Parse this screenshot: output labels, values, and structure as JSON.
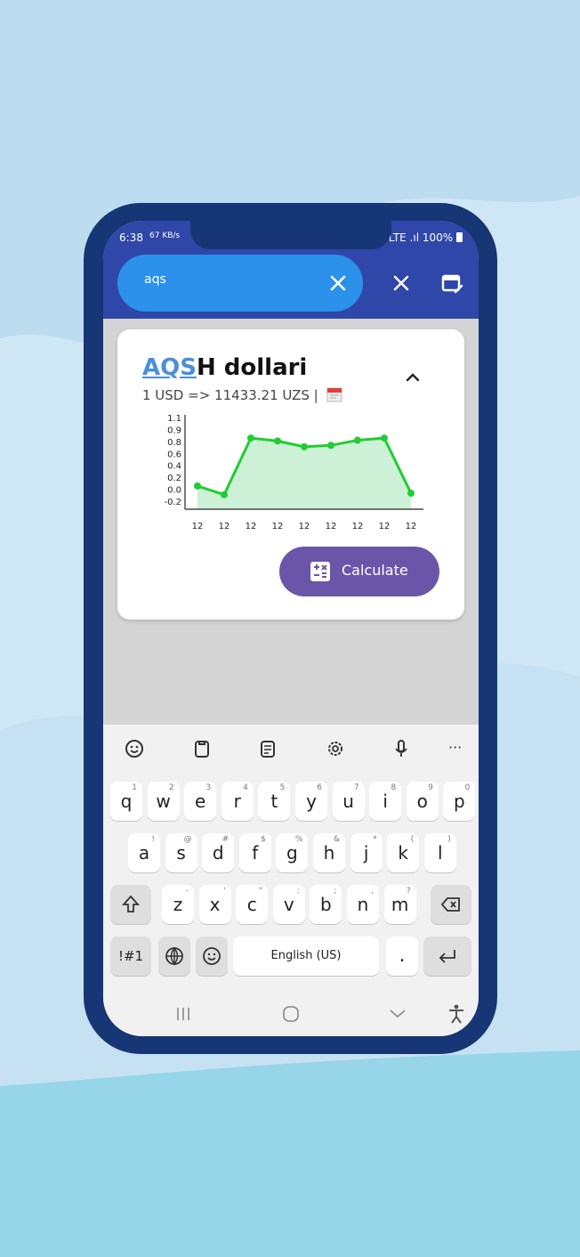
{
  "status_bar": {
    "time": "6:38",
    "net_speed": "67 KB/s",
    "signal": "LTE .ıl",
    "battery": "100%"
  },
  "search": {
    "value": "aqs"
  },
  "card": {
    "title_highlight": "AQS",
    "title_rest": "H dollari",
    "rate": "1 USD => 11433.21 UZS |",
    "calculate_label": "Calculate"
  },
  "chart_data": {
    "type": "line",
    "x": [
      "12",
      "12",
      "12",
      "12",
      "12",
      "12",
      "12",
      "12",
      "12"
    ],
    "values": [
      0.12,
      0.0,
      0.78,
      0.74,
      0.66,
      0.68,
      0.75,
      0.78,
      0.02
    ],
    "ylim": [
      -0.2,
      1.1
    ],
    "yticks": [
      "1.1",
      "0.9",
      "0.8",
      "0.6",
      "0.4",
      "0.2",
      "0.0",
      "-0.2"
    ],
    "title": "",
    "xlabel": "",
    "ylabel": "",
    "color": "#22cc33",
    "fill": "#c8f0d2"
  },
  "keyboard": {
    "row1": [
      {
        "k": "q",
        "h": "1"
      },
      {
        "k": "w",
        "h": "2"
      },
      {
        "k": "e",
        "h": "3"
      },
      {
        "k": "r",
        "h": "4"
      },
      {
        "k": "t",
        "h": "5"
      },
      {
        "k": "y",
        "h": "6"
      },
      {
        "k": "u",
        "h": "7"
      },
      {
        "k": "i",
        "h": "8"
      },
      {
        "k": "o",
        "h": "9"
      },
      {
        "k": "p",
        "h": "0"
      }
    ],
    "row2": [
      {
        "k": "a",
        "h": "!"
      },
      {
        "k": "s",
        "h": "@"
      },
      {
        "k": "d",
        "h": "#"
      },
      {
        "k": "f",
        "h": "$"
      },
      {
        "k": "g",
        "h": "%"
      },
      {
        "k": "h",
        "h": "&"
      },
      {
        "k": "j",
        "h": "*"
      },
      {
        "k": "k",
        "h": "("
      },
      {
        "k": "l",
        "h": ")"
      }
    ],
    "row3": [
      {
        "k": "z",
        "h": "-"
      },
      {
        "k": "x",
        "h": "'"
      },
      {
        "k": "c",
        "h": "\""
      },
      {
        "k": "v",
        "h": ":"
      },
      {
        "k": "b",
        "h": ";"
      },
      {
        "k": "n",
        "h": ","
      },
      {
        "k": "m",
        "h": "?"
      }
    ],
    "symbols_label": "!#1",
    "space_label": "English (US)",
    "period_label": ".",
    "toolbar_more": "···"
  },
  "colors": {
    "primary": "#2f47a8",
    "search": "#2b91ea",
    "accent": "#6a55a8",
    "frame": "#163675"
  }
}
